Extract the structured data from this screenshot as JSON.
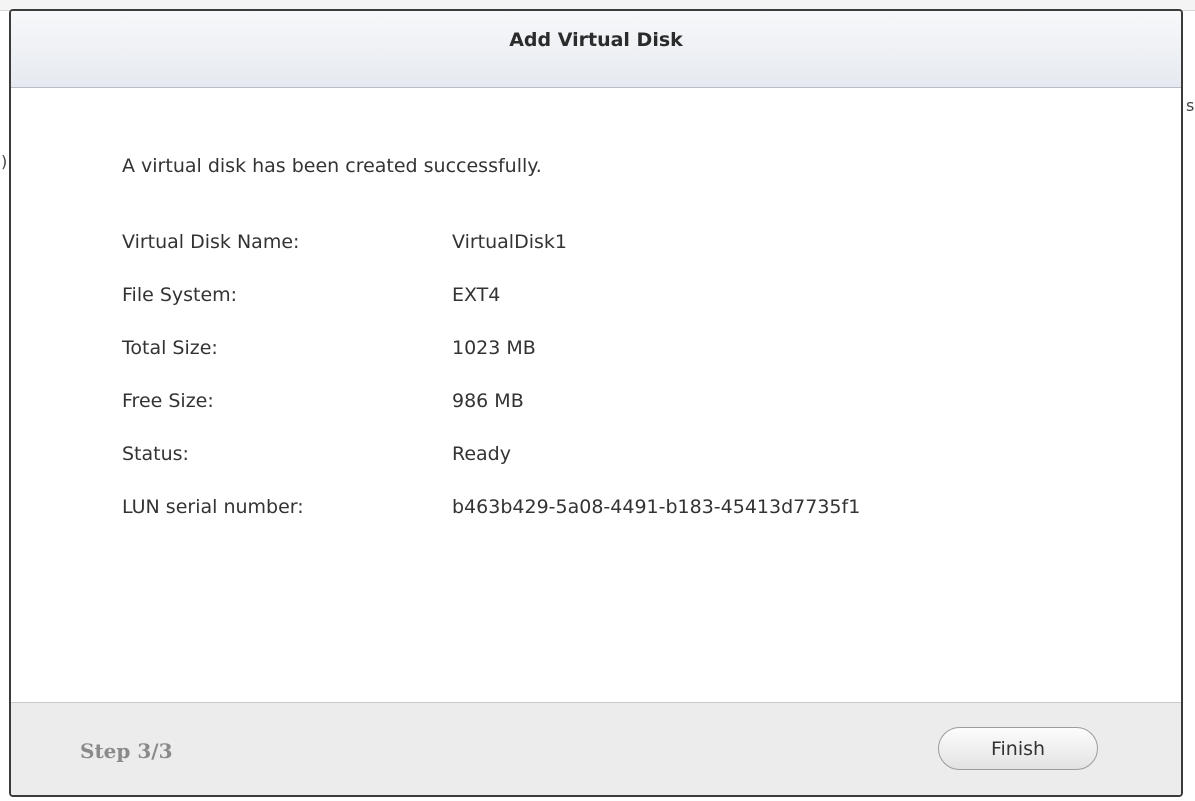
{
  "dialog": {
    "title": "Add Virtual Disk",
    "success_message": "A virtual disk has been created successfully.",
    "details": [
      {
        "label": "Virtual Disk Name:",
        "value": "VirtualDisk1"
      },
      {
        "label": "File System:",
        "value": "EXT4"
      },
      {
        "label": "Total Size:",
        "value": "1023 MB"
      },
      {
        "label": "Free Size:",
        "value": "986 MB"
      },
      {
        "label": "Status:",
        "value": "Ready"
      },
      {
        "label": "LUN serial number:",
        "value": "b463b429-5a08-4491-b183-45413d7735f1"
      }
    ],
    "footer": {
      "step": "Step 3/3",
      "finish_label": "Finish"
    }
  },
  "background": {
    "right_glyph": "s",
    "left_glyph": ")"
  }
}
